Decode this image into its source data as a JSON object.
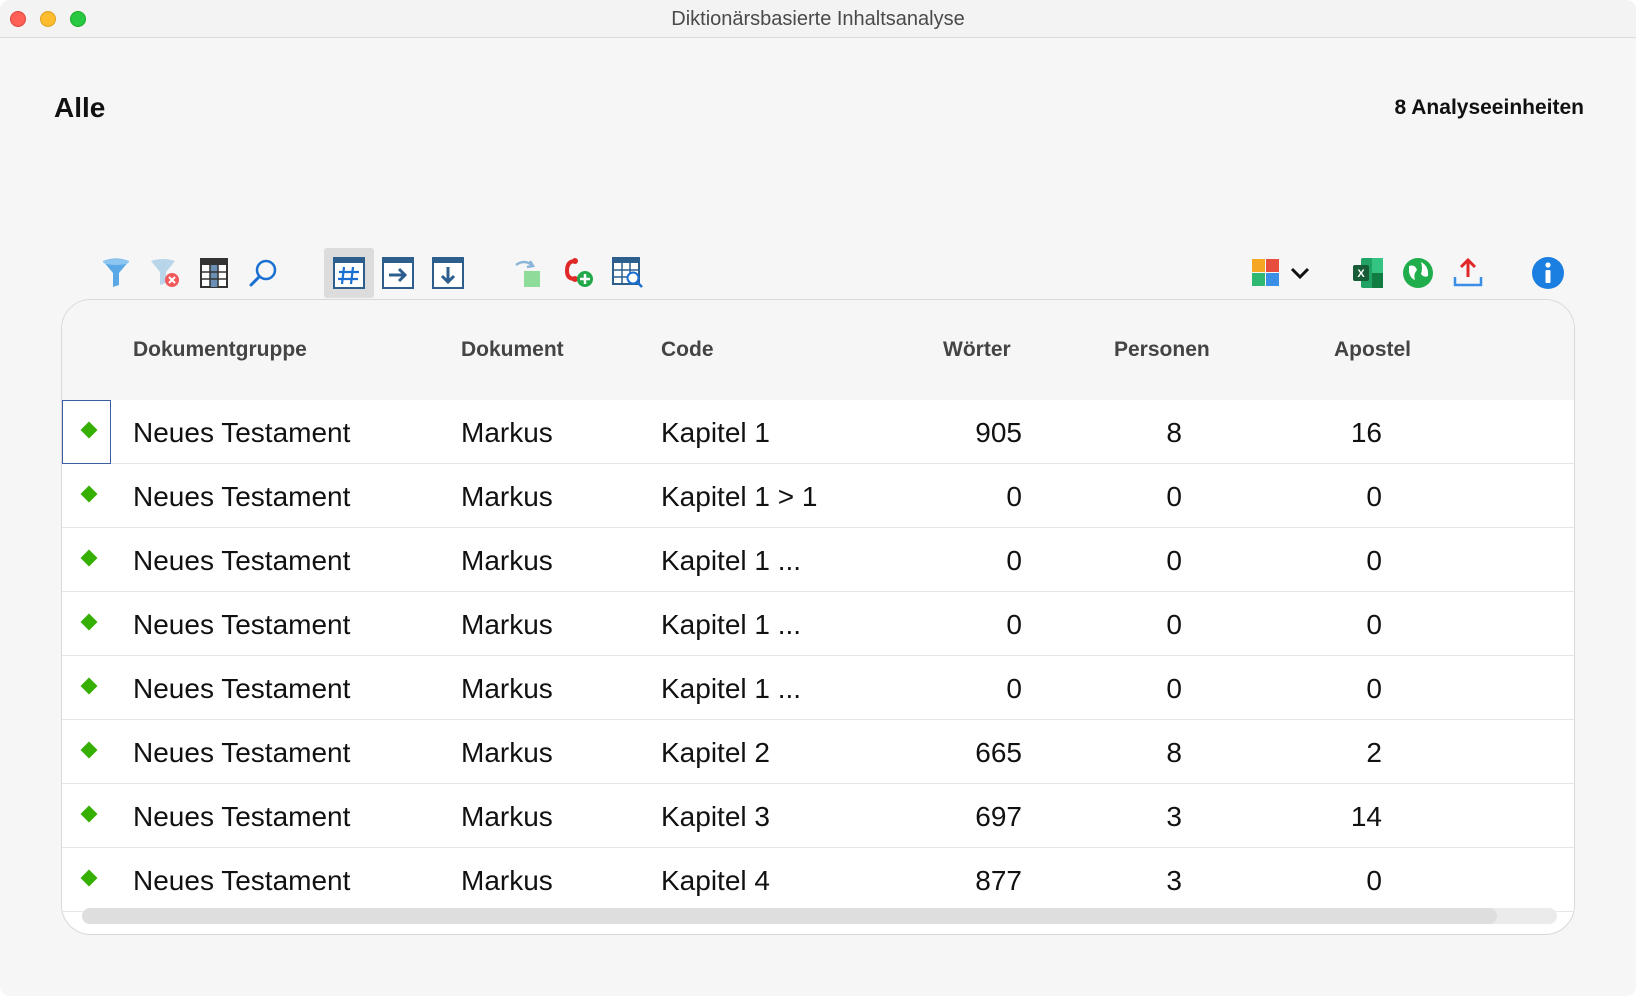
{
  "window": {
    "title": "Diktionärsbasierte Inhaltsanalyse"
  },
  "header": {
    "left": "Alle",
    "right": "8 Analyseeinheiten"
  },
  "toolbar": {
    "left_icons": [
      "filter-icon",
      "clear-filter-icon",
      "column-table-icon",
      "search-icon",
      "hash-table-icon",
      "arrow-right-box-icon",
      "arrow-down-box-icon",
      "transform-icon",
      "add-code-icon",
      "table-search-icon"
    ],
    "right_icons": [
      "puzzle-dropdown-icon",
      "excel-icon",
      "web-export-icon",
      "upload-icon",
      "info-icon"
    ]
  },
  "table": {
    "columns": [
      "Dokumentgruppe",
      "Dokument",
      "Code",
      "Wörter",
      "Personen",
      "Apostel"
    ],
    "rows": [
      [
        "Neues Testament",
        "Markus",
        "Kapitel 1",
        "905",
        "8",
        "16"
      ],
      [
        "Neues Testament",
        "Markus",
        "Kapitel 1 > 1",
        "0",
        "0",
        "0"
      ],
      [
        "Neues Testament",
        "Markus",
        "Kapitel 1 ...",
        "0",
        "0",
        "0"
      ],
      [
        "Neues Testament",
        "Markus",
        "Kapitel 1 ...",
        "0",
        "0",
        "0"
      ],
      [
        "Neues Testament",
        "Markus",
        "Kapitel 1 ...",
        "0",
        "0",
        "0"
      ],
      [
        "Neues Testament",
        "Markus",
        "Kapitel 2",
        "665",
        "8",
        "2"
      ],
      [
        "Neues Testament",
        "Markus",
        "Kapitel 3",
        "697",
        "3",
        "14"
      ],
      [
        "Neues Testament",
        "Markus",
        "Kapitel 4",
        "877",
        "3",
        "0"
      ]
    ]
  },
  "colors": {
    "accent_green": "#36b000",
    "info_blue": "#1a7fe0"
  }
}
